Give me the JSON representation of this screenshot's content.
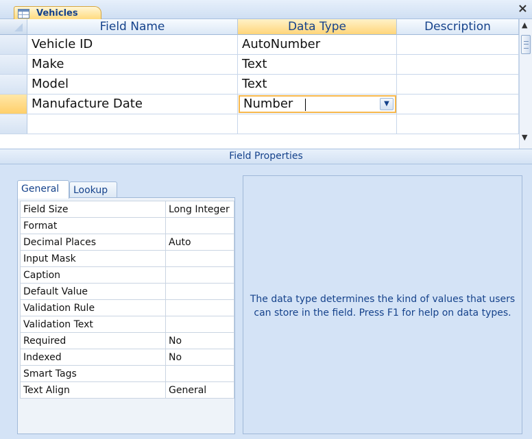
{
  "document_tab": {
    "label": "Vehicles",
    "close_glyph": "×"
  },
  "grid": {
    "columns": [
      "Field Name",
      "Data Type",
      "Description"
    ],
    "rows": [
      {
        "field_name": "Vehicle ID",
        "data_type": "AutoNumber",
        "description": ""
      },
      {
        "field_name": "Make",
        "data_type": "Text",
        "description": ""
      },
      {
        "field_name": "Model",
        "data_type": "Text",
        "description": ""
      },
      {
        "field_name": "Manufacture Date",
        "data_type": "Number",
        "description": ""
      },
      {
        "field_name": "",
        "data_type": "",
        "description": ""
      }
    ],
    "current_row_index": 3
  },
  "field_properties": {
    "title": "Field Properties",
    "tabs": [
      "General",
      "Lookup"
    ],
    "active_tab": "General",
    "properties": [
      {
        "name": "Field Size",
        "value": "Long Integer"
      },
      {
        "name": "Format",
        "value": ""
      },
      {
        "name": "Decimal Places",
        "value": "Auto"
      },
      {
        "name": "Input Mask",
        "value": ""
      },
      {
        "name": "Caption",
        "value": ""
      },
      {
        "name": "Default Value",
        "value": ""
      },
      {
        "name": "Validation Rule",
        "value": ""
      },
      {
        "name": "Validation Text",
        "value": ""
      },
      {
        "name": "Required",
        "value": "No"
      },
      {
        "name": "Indexed",
        "value": "No"
      },
      {
        "name": "Smart Tags",
        "value": ""
      },
      {
        "name": "Text Align",
        "value": "General"
      }
    ],
    "help_text": "The data type determines the kind of values that users can store in the field.  Press F1 for help on data types."
  },
  "colors": {
    "accent": "#15428b",
    "selection": "#ffd57a",
    "panel": "#d4e3f6"
  },
  "icons": {
    "table": "table-icon",
    "dropdown": "chevron-down-icon",
    "close": "close-icon"
  }
}
